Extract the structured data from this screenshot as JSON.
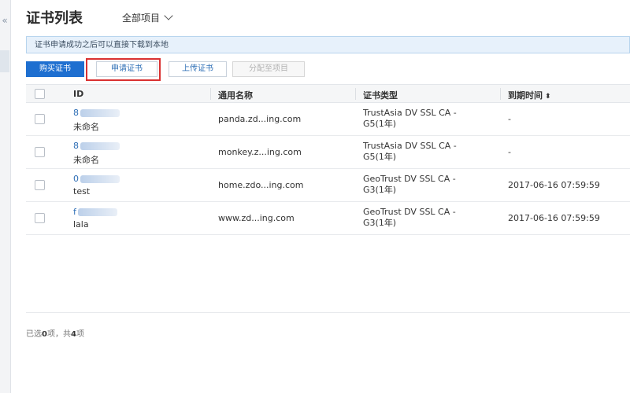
{
  "page": {
    "title": "证书列表",
    "project_selector": "全部项目",
    "notice": "证书申请成功之后可以直接下载到本地"
  },
  "toolbar": {
    "buy": "购买证书",
    "apply": "申请证书",
    "upload": "上传证书",
    "assign": "分配至项目"
  },
  "table": {
    "headers": [
      "ID",
      "通用名称",
      "证书类型",
      "到期时间"
    ],
    "rows": [
      {
        "id": "8",
        "alias": "未命名",
        "common_name": "panda.zd...ing.com",
        "type_line1": "TrustAsia DV SSL CA -",
        "type_line2": "G5(1年)",
        "expiry": "-"
      },
      {
        "id": "8",
        "alias": "未命名",
        "common_name": "monkey.z...ing.com",
        "type_line1": "TrustAsia DV SSL CA -",
        "type_line2": "G5(1年)",
        "expiry": "-"
      },
      {
        "id": "0",
        "alias": "test",
        "common_name": "home.zdo...ing.com",
        "type_line1": "GeoTrust DV SSL CA -",
        "type_line2": "G3(1年)",
        "expiry": "2017-06-16 07:59:59"
      },
      {
        "id": "f",
        "alias": "lala",
        "common_name": "www.zd...ing.com",
        "type_line1": "GeoTrust DV SSL CA -",
        "type_line2": "G3(1年)",
        "expiry": "2017-06-16 07:59:59"
      }
    ]
  },
  "footer": {
    "prefix": "已选",
    "selected": "0",
    "middle": "项，共",
    "total": "4",
    "suffix": "项"
  },
  "colors": {
    "primary": "#1e6fd0",
    "highlight_box": "#d93131",
    "notice_bg": "#e7f1fb"
  },
  "icons": {
    "sidebar_toggle": "double-chevron-left-icon",
    "project_dropdown": "chevron-down-icon",
    "sort": "sort-icon"
  }
}
